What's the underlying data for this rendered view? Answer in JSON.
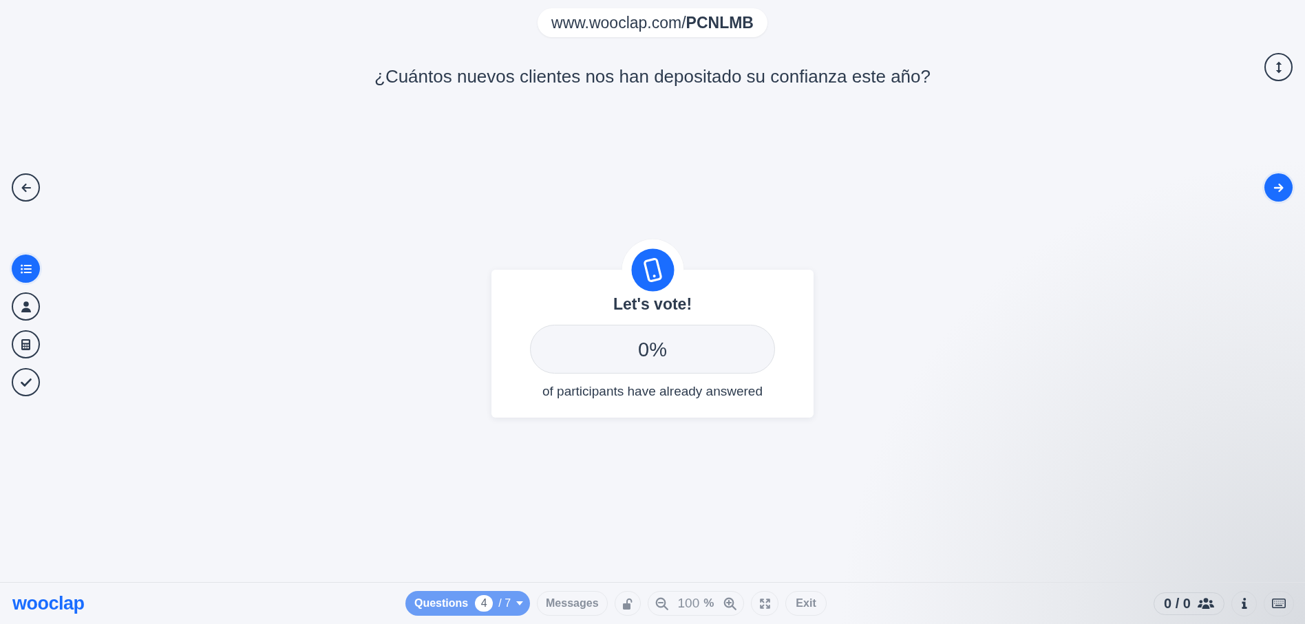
{
  "header": {
    "url": "www.wooclap.com/**PCNLMB**",
    "question": "¿Cuántos nuevos clientes nos han depositado su confianza este año?"
  },
  "sidebar": {
    "items": [
      {
        "selected": true
      },
      {
        "selected": false
      },
      {
        "selected": false
      },
      {
        "selected": false
      }
    ]
  },
  "card": {
    "title": "Let's vote!",
    "answer_rate": "0%",
    "caption": "of participants have already answered"
  },
  "bottom_bar": {
    "logo": "wooclap",
    "questions": {
      "label": "Questions",
      "current": "4",
      "total": "/ 7",
      "disabled": true
    },
    "messages": {
      "label": "Messages",
      "disabled": true
    },
    "lock": {
      "disabled": true
    },
    "zoom": {
      "value": "100",
      "unit": "%",
      "disabled": true
    },
    "fullscreen": {
      "disabled": true
    },
    "exit": {
      "label": "Exit",
      "disabled": true
    },
    "participants": {
      "count": "0 / 0"
    }
  }
}
